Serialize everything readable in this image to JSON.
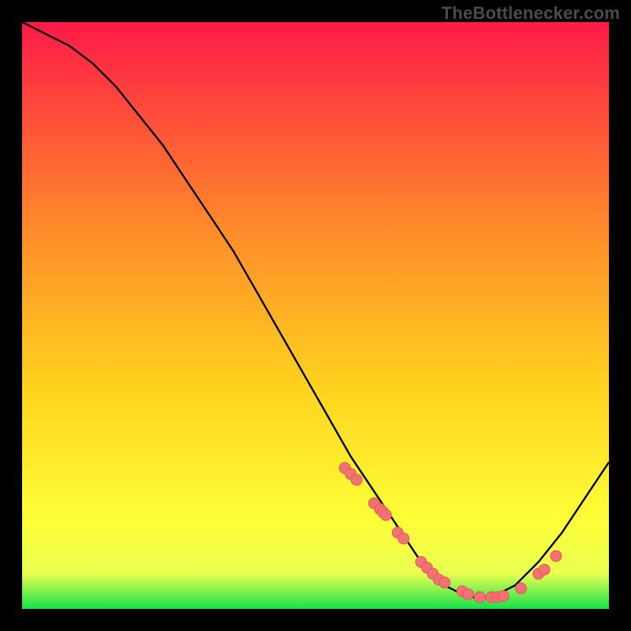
{
  "watermark": "TheBottlenecker.com",
  "colors": {
    "gradient_top": "#ff1a48",
    "gradient_mid1": "#ff6a2c",
    "gradient_mid2": "#ffd21e",
    "gradient_mid3": "#ffff38",
    "gradient_bottom": "#16e24a",
    "curve": "#000000",
    "marker": "#f07272",
    "marker_stroke": "#e85858"
  },
  "chart_data": {
    "type": "line",
    "title": "",
    "xlabel": "",
    "ylabel": "",
    "xlim": [
      0,
      100
    ],
    "ylim": [
      0,
      100
    ],
    "series": [
      {
        "name": "bottleneck-curve",
        "x": [
          0,
          4,
          8,
          12,
          16,
          20,
          24,
          28,
          32,
          36,
          40,
          44,
          48,
          52,
          56,
          60,
          64,
          68,
          72,
          76,
          80,
          84,
          88,
          92,
          96,
          100
        ],
        "y": [
          100,
          98,
          96,
          93,
          89,
          84,
          79,
          73,
          67,
          61,
          54,
          47,
          40,
          33,
          26,
          20,
          14,
          8,
          4,
          2,
          2,
          4,
          8,
          13,
          19,
          25
        ]
      }
    ],
    "markers": {
      "name": "highlight-points",
      "x": [
        55,
        56,
        57,
        60,
        61,
        61.5,
        62,
        64,
        65,
        68,
        69,
        70,
        71,
        72,
        75,
        76,
        78,
        80,
        81,
        82,
        85,
        88,
        89,
        91
      ],
      "y": [
        24,
        23,
        22,
        18,
        17,
        16.5,
        16,
        13,
        12,
        8,
        7,
        6,
        5,
        4.5,
        3,
        2.5,
        2,
        2,
        2,
        2.2,
        3.5,
        6,
        6.7,
        9
      ]
    },
    "grid": false,
    "legend": false
  }
}
